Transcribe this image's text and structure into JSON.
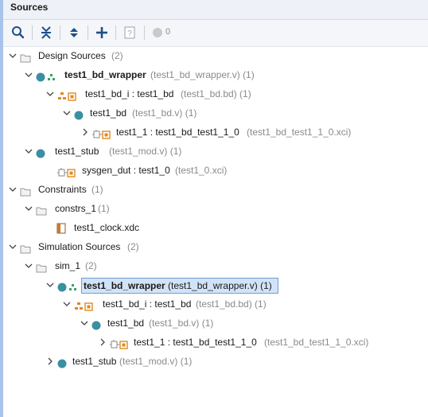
{
  "panel": {
    "title": "Sources",
    "compile_order_count": "0"
  },
  "toolbar": {
    "search": "search-icon",
    "collapse_all": "collapse-all-icon",
    "expand_all": "expand-all-icon",
    "add": "add-icon",
    "help": "help-icon",
    "status": "status-dot-icon"
  },
  "tree": {
    "design_sources": {
      "label": "Design Sources",
      "count": "(2)"
    },
    "wrapper1": {
      "label": "test1_bd_wrapper",
      "file": "(test1_bd_wrapper.v) (1)"
    },
    "bd_i1": {
      "label": "test1_bd_i : test1_bd",
      "file": "(test1_bd.bd) (1)"
    },
    "bd1": {
      "label": "test1_bd",
      "file": "(test1_bd.v) (1)"
    },
    "t1_1a": {
      "label": "test1_1 : test1_bd_test1_1_0",
      "file": "(test1_bd_test1_1_0.xci)"
    },
    "stub1": {
      "label": "test1_stub",
      "file": "(test1_mod.v) (1)"
    },
    "sysgen": {
      "label": "sysgen_dut : test1_0",
      "file": "(test1_0.xci)"
    },
    "constraints": {
      "label": "Constraints",
      "count": "(1)"
    },
    "constrs": {
      "label": "constrs_1",
      "count": "(1)"
    },
    "xdc": {
      "label": "test1_clock.xdc"
    },
    "sim_sources": {
      "label": "Simulation Sources",
      "count": "(2)"
    },
    "sim1": {
      "label": "sim_1",
      "count": "(2)"
    },
    "wrapper2": {
      "label": "test1_bd_wrapper",
      "file": "(test1_bd_wrapper.v) (1)"
    },
    "bd_i2": {
      "label": "test1_bd_i : test1_bd",
      "file": "(test1_bd.bd) (1)"
    },
    "bd2": {
      "label": "test1_bd",
      "file": "(test1_bd.v) (1)"
    },
    "t1_1b": {
      "label": "test1_1 : test1_bd_test1_1_0",
      "file": "(test1_bd_test1_1_0.xci)"
    },
    "stub2": {
      "label": "test1_stub",
      "file": "(test1_mod.v) (1)"
    }
  },
  "colors": {
    "module_dot": "#3a8fa3",
    "ip_orange": "#e08a1e",
    "selection": "#d3e3f7"
  }
}
